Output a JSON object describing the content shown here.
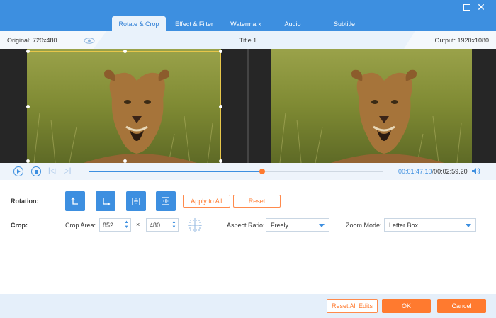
{
  "tabs": [
    {
      "label": "Rotate & Crop",
      "active": true
    },
    {
      "label": "Effect & Filter",
      "active": false
    },
    {
      "label": "Watermark",
      "active": false
    },
    {
      "label": "Audio",
      "active": false
    },
    {
      "label": "Subtitle",
      "active": false
    }
  ],
  "info": {
    "original": "Original: 720x480",
    "title": "Title 1",
    "output": "Output: 1920x1080"
  },
  "playback": {
    "current_time": "00:01:47.10",
    "separator": "/",
    "total_time": "00:02:59.20",
    "progress": 0.59
  },
  "rotation": {
    "label": "Rotation:",
    "apply_all_label": "Apply to All",
    "reset_label": "Reset"
  },
  "crop": {
    "label": "Crop:",
    "area_label": "Crop Area:",
    "width": "852",
    "times": "×",
    "height": "480",
    "aspect_label": "Aspect Ratio:",
    "aspect_value": "Freely",
    "zoom_label": "Zoom Mode:",
    "zoom_value": "Letter Box"
  },
  "footer": {
    "reset_all_label": "Reset All Edits",
    "ok_label": "OK",
    "cancel_label": "Cancel"
  },
  "colors": {
    "accent": "#3d8fe0",
    "orange": "#ff7a2f",
    "crop_frame": "#e7c64a"
  }
}
